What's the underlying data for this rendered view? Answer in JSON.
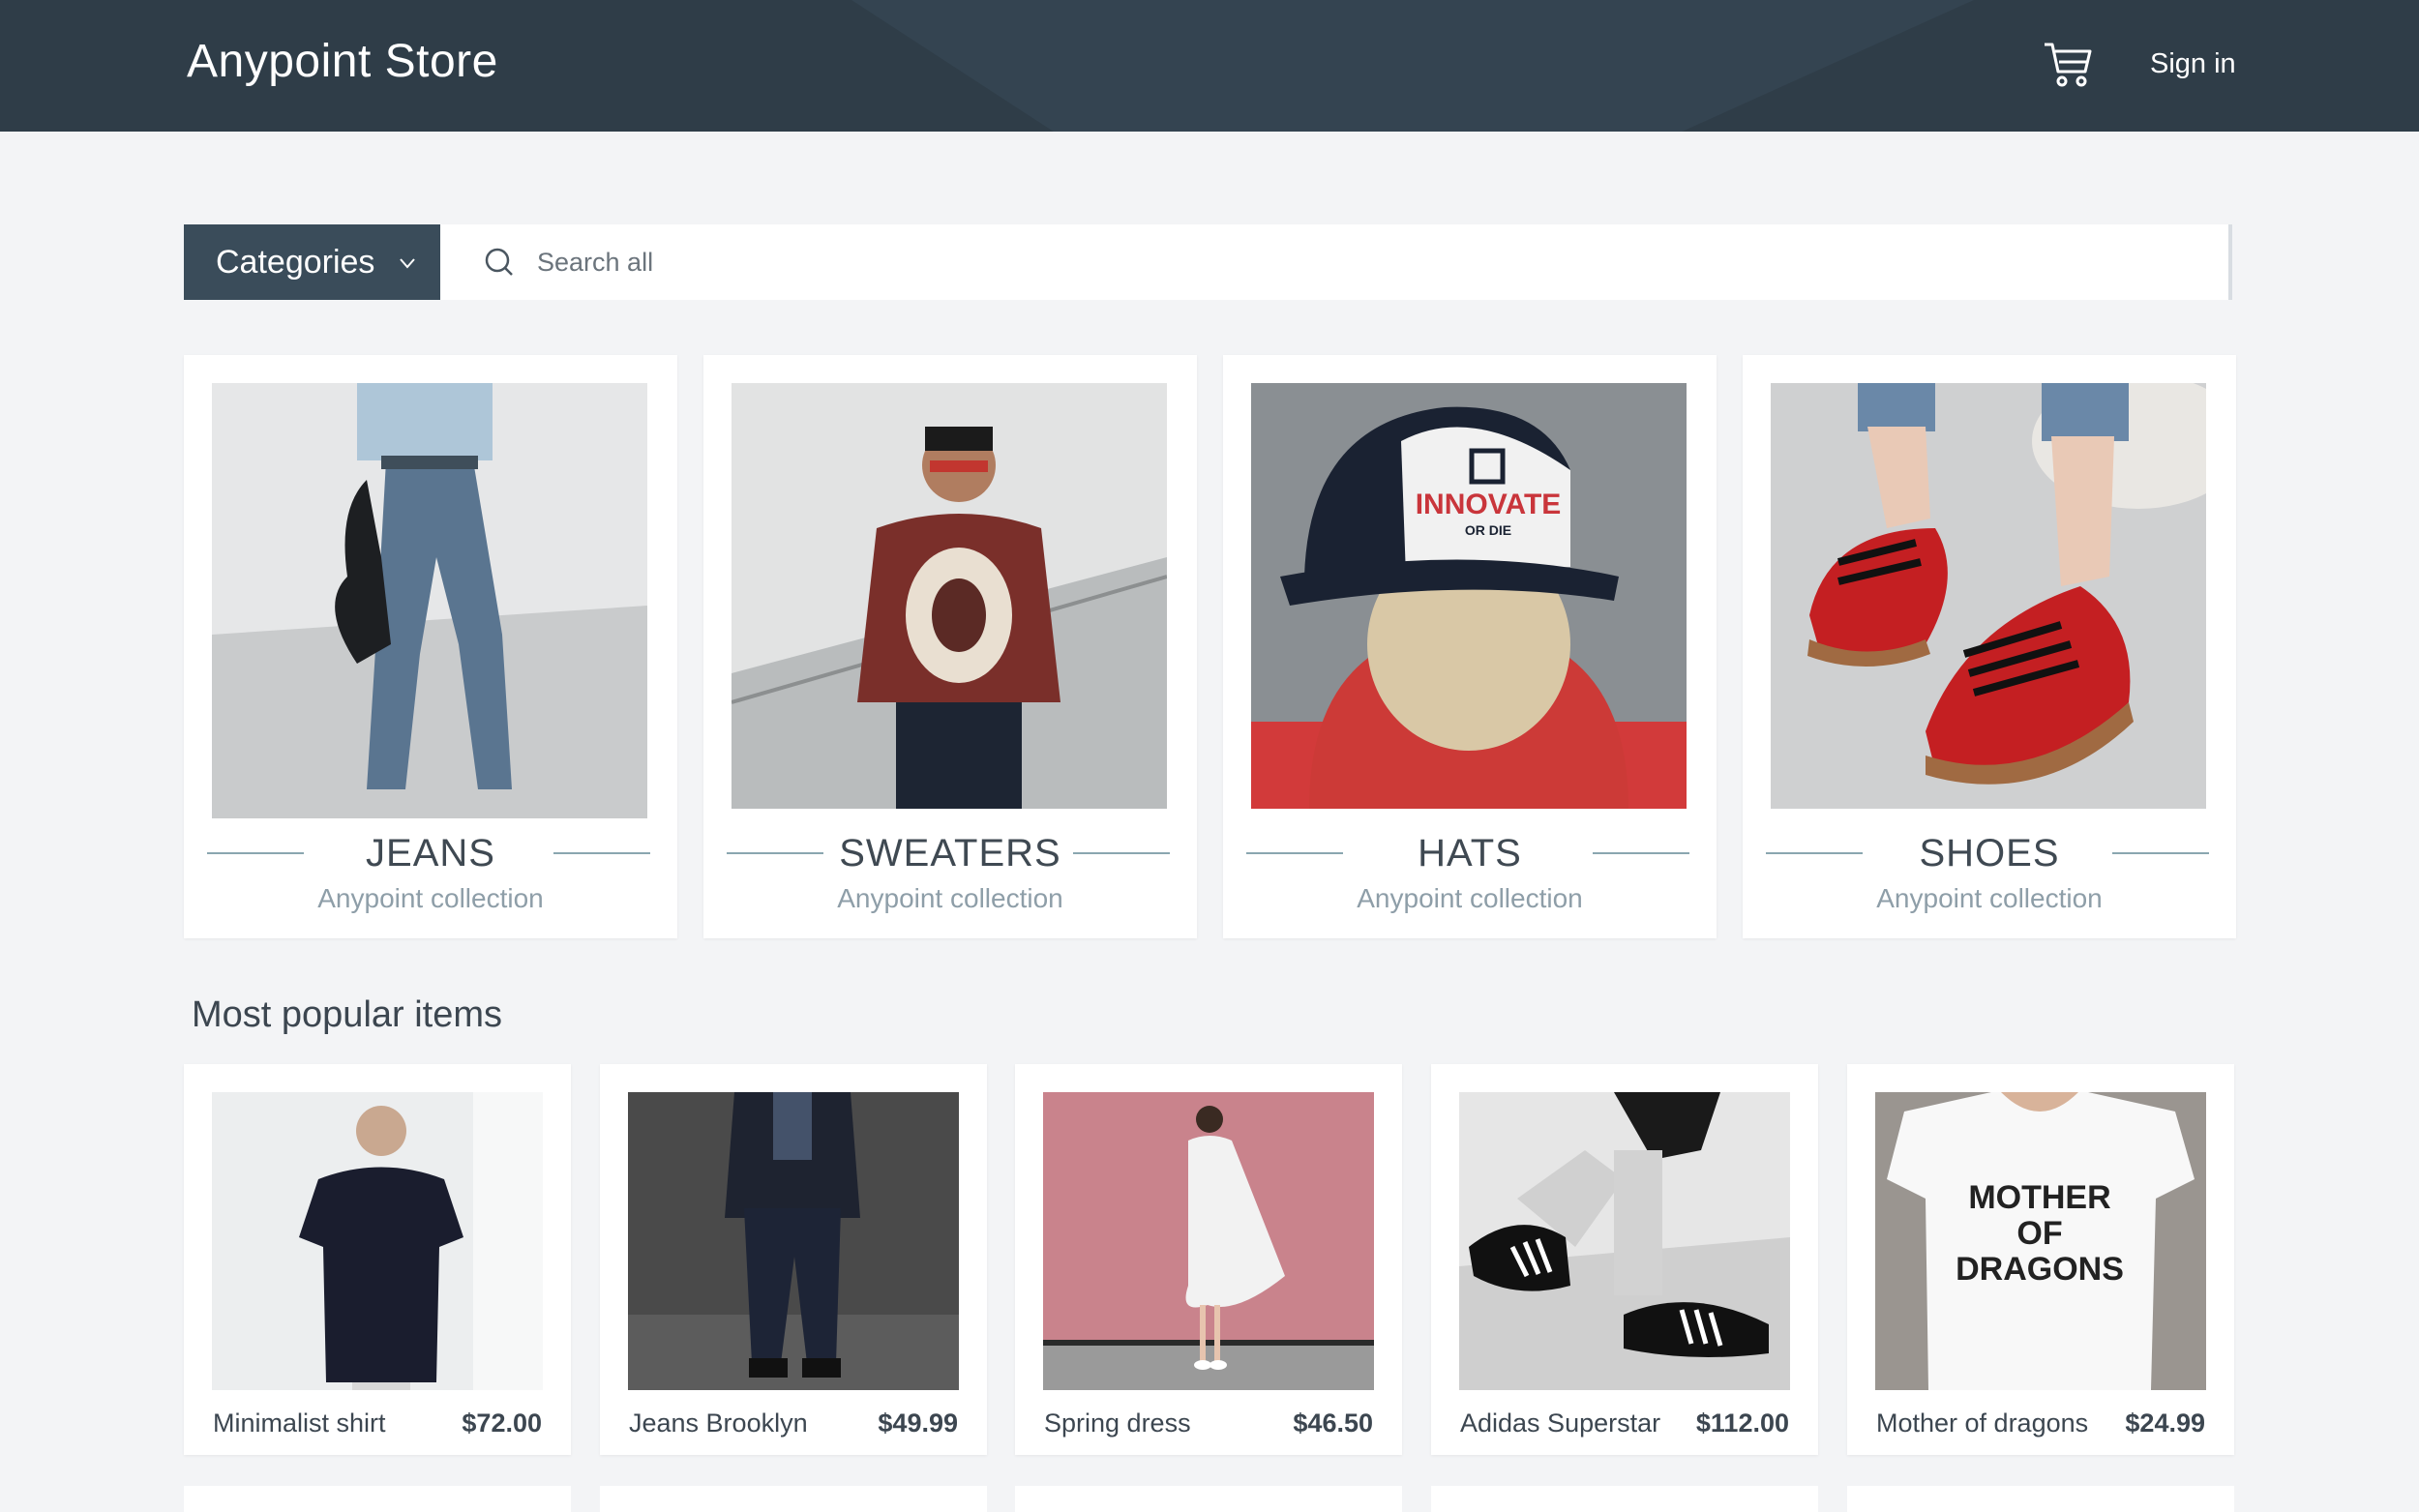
{
  "header": {
    "brand": "Anypoint Store",
    "sign_in": "Sign in",
    "cart_icon": "shopping-cart-icon"
  },
  "toolbar": {
    "categories_label": "Categories",
    "search_placeholder": "Search all"
  },
  "categories": [
    {
      "title": "JEANS",
      "subtitle": "Anypoint collection"
    },
    {
      "title": "SWEATERS",
      "subtitle": "Anypoint collection"
    },
    {
      "title": "HATS",
      "subtitle": "Anypoint collection"
    },
    {
      "title": "SHOES",
      "subtitle": "Anypoint collection"
    }
  ],
  "popular": {
    "title": "Most popular items",
    "items": [
      {
        "name": "Minimalist shirt",
        "price": "$72.00"
      },
      {
        "name": "Jeans Brooklyn",
        "price": "$49.99"
      },
      {
        "name": "Spring dress",
        "price": "$46.50"
      },
      {
        "name": "Adidas Superstar",
        "price": "$112.00"
      },
      {
        "name": "Mother of dragons",
        "price": "$24.99"
      }
    ]
  },
  "colors": {
    "header_bg": "#2f3d48",
    "categories_bg": "#3a4c5a",
    "page_bg": "#f3f4f6"
  },
  "images": {
    "hat_text_main": "INNOVATE",
    "hat_text_sub": "OR DIE",
    "tshirt_text": [
      "MOTHER",
      "OF",
      "DRAGONS"
    ]
  }
}
